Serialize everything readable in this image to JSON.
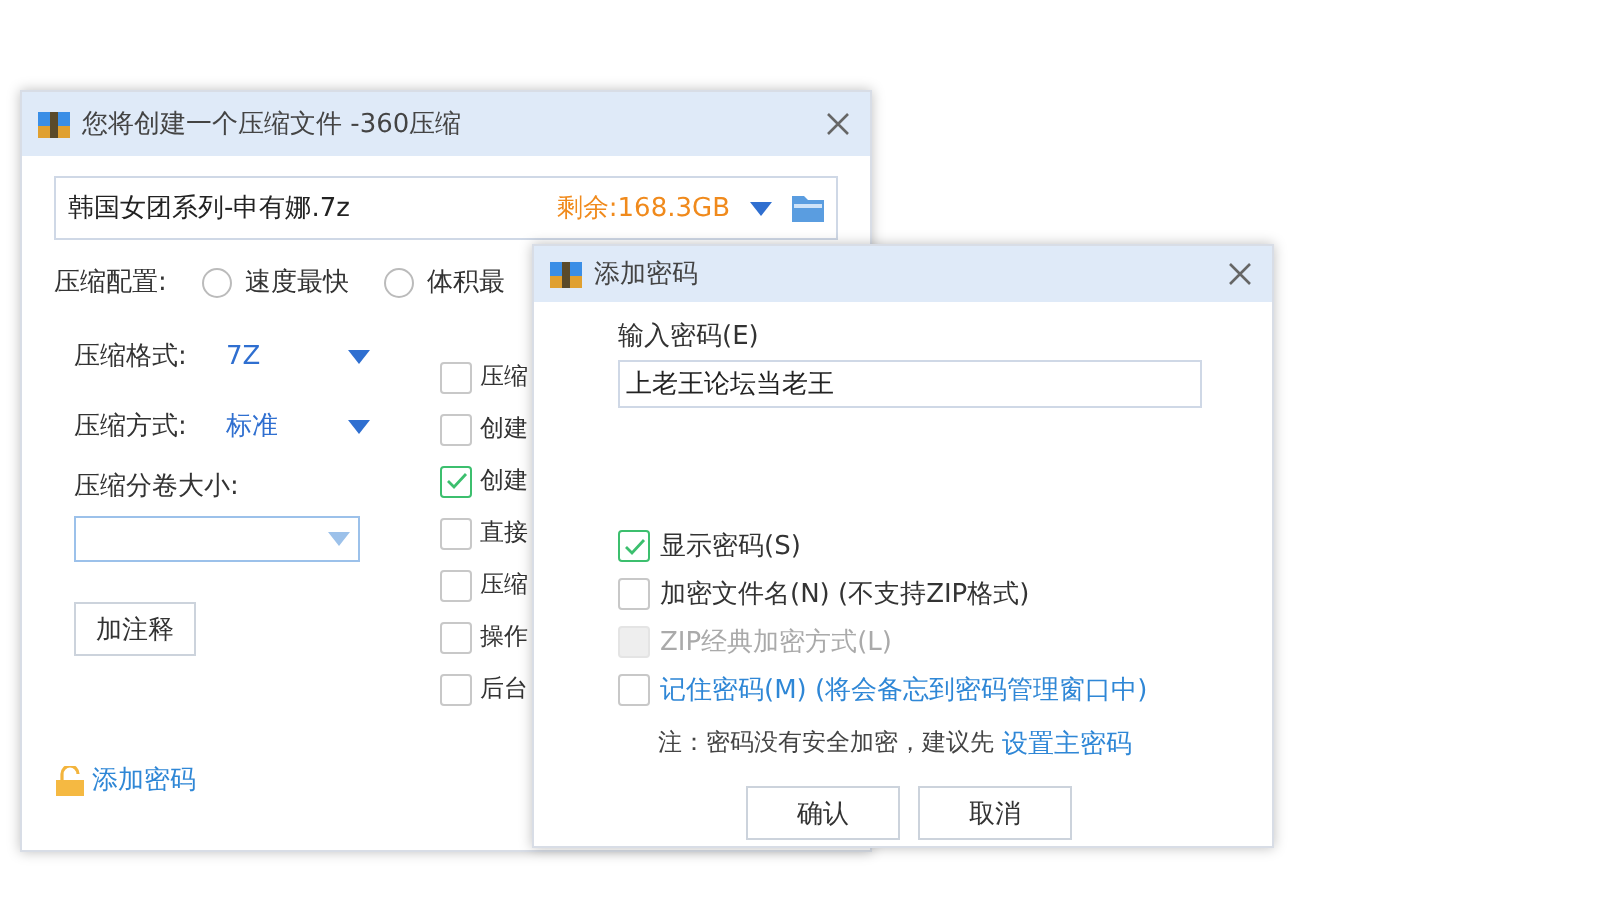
{
  "main_window": {
    "title": "您将创建一个压缩文件 -360压缩",
    "file": {
      "name": "韩国女团系列-申有娜.7z",
      "free_space": "剩余:168.3GB"
    },
    "profile": {
      "label": "压缩配置:",
      "options": [
        {
          "label": "速度最快",
          "selected": false
        },
        {
          "label": "体积最",
          "selected": false
        }
      ]
    },
    "format": {
      "label": "压缩格式:",
      "value": "7Z"
    },
    "method": {
      "label": "压缩方式:",
      "value": "标准"
    },
    "split": {
      "label": "压缩分卷大小:"
    },
    "comment_button": "加注释",
    "options": [
      {
        "label": "压缩",
        "checked": false
      },
      {
        "label": "创建",
        "checked": false
      },
      {
        "label": "创建",
        "checked": true
      },
      {
        "label": "直接",
        "checked": false
      },
      {
        "label": "压缩",
        "checked": false
      },
      {
        "label": "操作",
        "checked": false
      },
      {
        "label": "后台",
        "checked": false
      }
    ],
    "add_password_link": "添加密码"
  },
  "password_dialog": {
    "title": "添加密码",
    "password_label": "输入密码(E)",
    "password_value": "上老王论坛当老王",
    "options": [
      {
        "label": "显示密码(S)",
        "checked": true,
        "disabled": false,
        "kind": "plain"
      },
      {
        "label": "加密文件名(N) (不支持ZIP格式)",
        "checked": false,
        "disabled": false,
        "kind": "plain"
      },
      {
        "label": "ZIP经典加密方式(L)",
        "checked": false,
        "disabled": true,
        "kind": "plain"
      },
      {
        "label": "记住密码(M) (将会备忘到密码管理窗口中)",
        "checked": false,
        "disabled": false,
        "kind": "link"
      }
    ],
    "note": "注：密码没有安全加密，建议先",
    "note_link": "设置主密码",
    "buttons": [
      "确认",
      "取消"
    ]
  }
}
